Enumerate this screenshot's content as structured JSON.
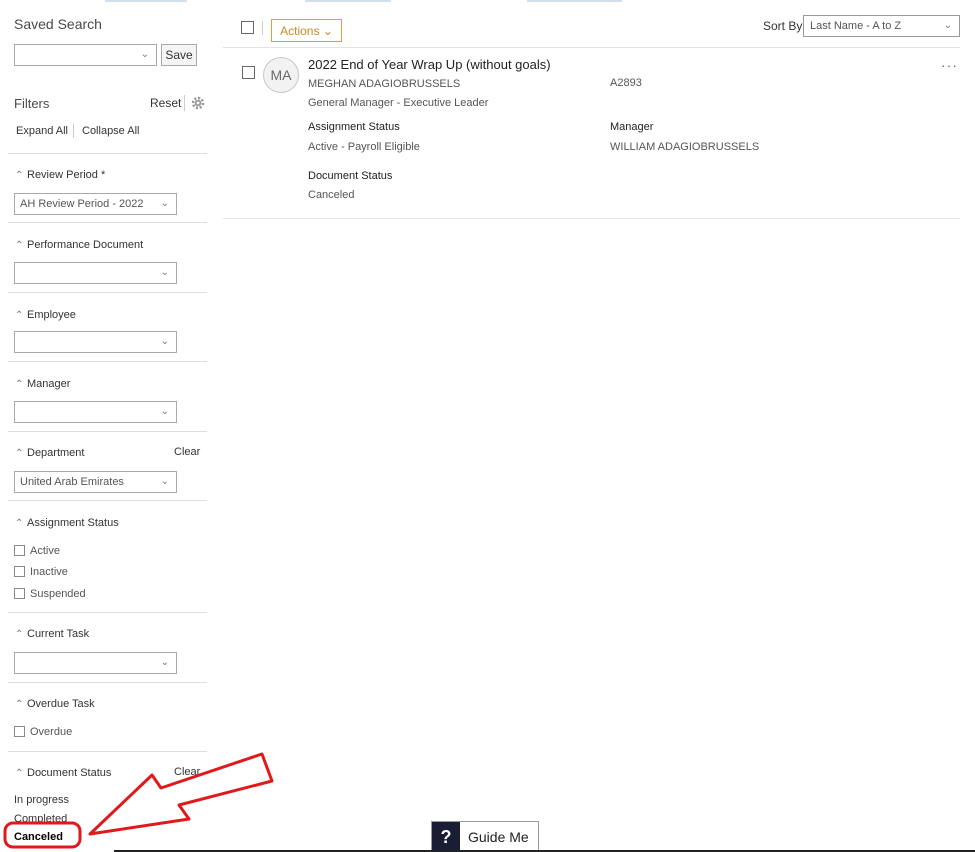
{
  "saved_search": {
    "title": "Saved Search",
    "value": "",
    "save_label": "Save"
  },
  "filters": {
    "title": "Filters",
    "reset_label": "Reset",
    "expand_all": "Expand All",
    "collapse_all": "Collapse All",
    "clear_label": "Clear",
    "review_period": {
      "label": "Review Period *",
      "value": "AH Review Period - 2022"
    },
    "performance_document": {
      "label": "Performance Document",
      "value": ""
    },
    "employee": {
      "label": "Employee",
      "value": ""
    },
    "manager": {
      "label": "Manager",
      "value": ""
    },
    "department": {
      "label": "Department",
      "value": "United Arab Emirates"
    },
    "assignment_status": {
      "label": "Assignment Status",
      "options": [
        "Active",
        "Inactive",
        "Suspended"
      ]
    },
    "current_task": {
      "label": "Current Task",
      "value": ""
    },
    "overdue_task": {
      "label": "Overdue Task",
      "options": [
        "Overdue"
      ]
    },
    "document_status": {
      "label": "Document Status",
      "options": [
        "In progress",
        "Completed",
        "Canceled"
      ]
    }
  },
  "toolbar": {
    "actions_label": "Actions",
    "sort_by_label": "Sort By",
    "sort_value": "Last Name - A to Z"
  },
  "card": {
    "initials": "MA",
    "title": "2022 End of Year Wrap Up (without goals)",
    "employee_name": "MEGHAN ADAGIOBRUSSELS",
    "employee_id": "A2893",
    "job_title": "General Manager - Executive Leader",
    "assignment_status_label": "Assignment Status",
    "assignment_status_value": "Active - Payroll Eligible",
    "manager_label": "Manager",
    "manager_value": "WILLIAM ADAGIOBRUSSELS",
    "document_status_label": "Document Status",
    "document_status_value": "Canceled"
  },
  "guide_me": {
    "icon_text": "?",
    "label": "Guide Me"
  },
  "colors": {
    "accent": "#d7a042",
    "annotation": "#e0191b",
    "guide_dark": "#1a1d33"
  }
}
